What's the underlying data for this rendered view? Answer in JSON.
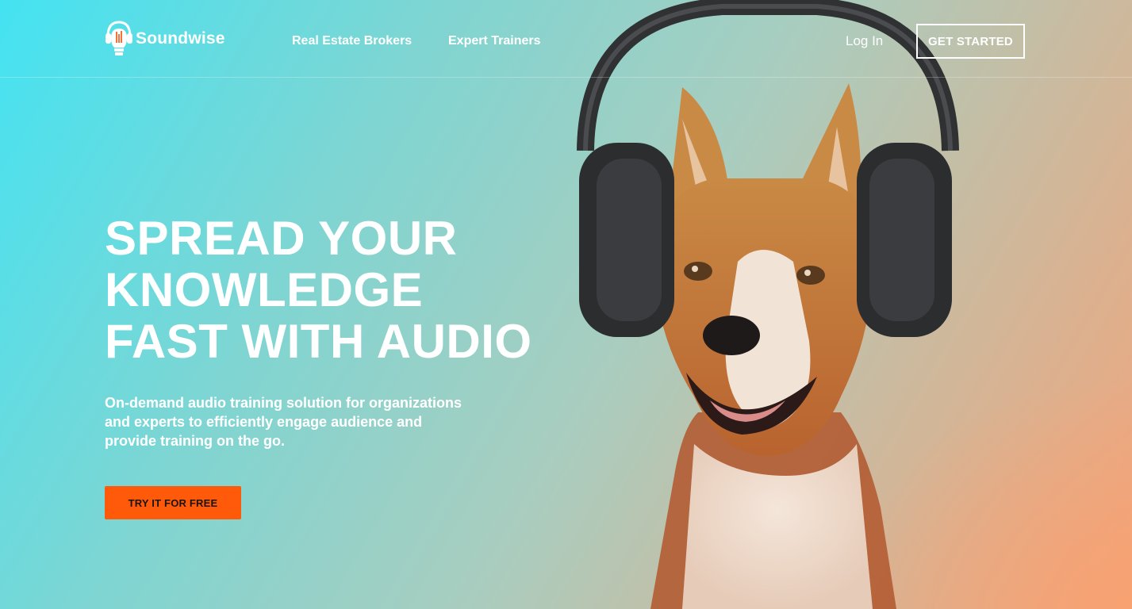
{
  "brand": {
    "name": "Soundwise",
    "logo_icon": "lightbulb-headphones-icon"
  },
  "nav": {
    "links": [
      "Real Estate Brokers",
      "Expert Trainers"
    ],
    "login_label": "Log In",
    "cta_label": "GET STARTED"
  },
  "hero": {
    "headline": [
      "SPREAD YOUR",
      "KNOWLEDGE",
      "FAST WITH AUDIO"
    ],
    "subtext": "On-demand audio training solution for organizations and experts to efficiently engage audience and provide training on the go.",
    "cta_label": "TRY IT FOR FREE",
    "image_subject": "dog wearing headphones"
  },
  "colors": {
    "accent": "#ff5a0a",
    "gradient_start": "#44e3f2",
    "gradient_end": "#f3a47a"
  }
}
